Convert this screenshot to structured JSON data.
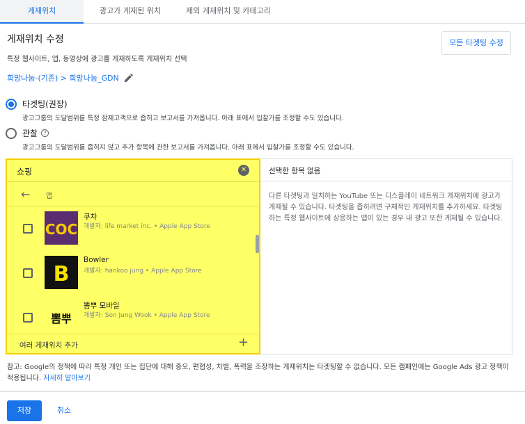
{
  "tabs": [
    {
      "label": "게재위치",
      "active": true
    },
    {
      "label": "광고가 게재된 위치",
      "active": false
    },
    {
      "label": "제외 게재위치 및 카테고리",
      "active": false
    }
  ],
  "header": {
    "title": "게재위치 수정",
    "description": "특정 웹사이트, 앱, 동영상에 광고를 게재하도록 게재위치 선택",
    "edit_all_button": "모든 타겟팅 수정"
  },
  "breadcrumb": "희망나눔-(기존) > 희망나눔_GDN",
  "options": {
    "targeting": {
      "label": "타겟팅(권장)",
      "description": "광고그룹의 도달범위를 특정 잠재고객으로 좁히고 보고서를 가져옵니다. 아래 표에서 입찰가를 조정할 수도 있습니다.",
      "selected": true
    },
    "observation": {
      "label": "관찰",
      "description": "광고그룹의 도달범위를 좁히지 않고 추가 항목에 관한 보고서를 가져옵니다. 아래 표에서 입찰가를 조정할 수도 있습니다.",
      "selected": false
    }
  },
  "picker": {
    "search_value": "쇼핑",
    "nav_label": "앱",
    "items": [
      {
        "title": "쿠차",
        "subtitle": "개발자: life market inc. • Apple App Store",
        "thumb_text": "COC",
        "thumb_bg": "#5b2d6e",
        "thumb_fg": "#f5c800"
      },
      {
        "title": "Bowler",
        "subtitle": "개발자: hankoo jung • Apple App Store",
        "thumb_text": "B",
        "thumb_bg": "#111111",
        "thumb_fg": "#f5e000"
      },
      {
        "title": "뽐뿌 모바일",
        "subtitle": "개발자: Son Jung Wook • Apple App Store",
        "thumb_text": "뽐뿌",
        "thumb_bg": "#ffff66",
        "thumb_fg": "#111111"
      }
    ],
    "add_multiple_label": "여러 게재위치 추가"
  },
  "selected_pane": {
    "heading": "선택한 항목 없음",
    "body": "다른 타겟팅과 일치하는 YouTube 또는 디스플레이 네트워크 게재위치에 광고가 게재될 수 있습니다. 타겟팅을 좁히려면 구체적인 게재위치를 추가하세요. 타겟팅하는 특정 웹사이트에 상응하는 앱이 있는 경우 내 광고 또한 게재될 수 있습니다."
  },
  "note": {
    "text": "참고: Google의 정책에 따라 특정 개인 또는 집단에 대해 증오, 편협성, 차별, 폭력을 조장하는 게재위치는 타겟팅할 수 없습니다. 모든 캠페인에는 Google Ads 광고 정책이 적용됩니다. ",
    "link": "자세히 알아보기"
  },
  "footer": {
    "save_label": "저장",
    "cancel_label": "취소"
  },
  "colors": {
    "accent": "#1a73e8",
    "highlight": "#ffff66"
  }
}
